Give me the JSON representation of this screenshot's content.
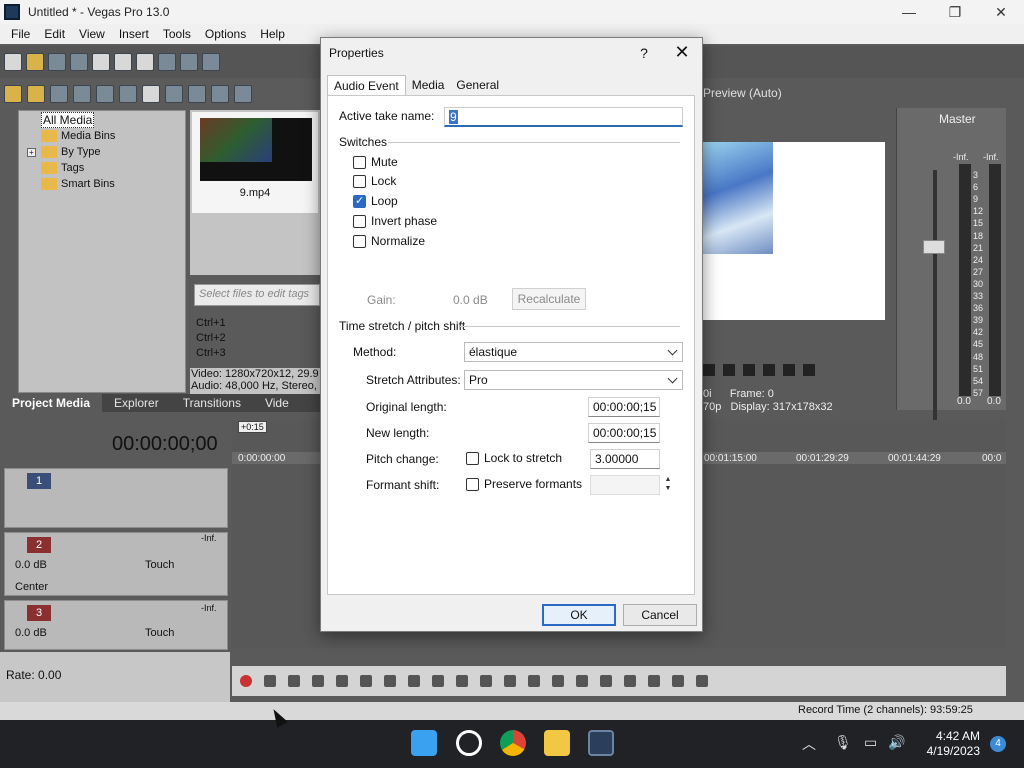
{
  "window": {
    "title": "Untitled * - Vegas Pro 13.0",
    "minimize": "—",
    "maximize": "❐",
    "close": "✕"
  },
  "menu": [
    "File",
    "Edit",
    "View",
    "Insert",
    "Tools",
    "Options",
    "Help"
  ],
  "project_media": {
    "tree": [
      "All Media",
      "Media Bins",
      "By Type",
      "Tags",
      "Smart Bins"
    ],
    "tree_expander": "+",
    "thumbnail_label": "9.mp4",
    "tags_placeholder": "Select files to edit tags",
    "shortcuts": [
      "Ctrl+1",
      "Ctrl+2",
      "Ctrl+3"
    ],
    "info_line1": "Video: 1280x720x12, 29.9",
    "info_line2": "Audio: 48,000 Hz, Stereo,",
    "tabs": [
      "Project Media",
      "Explorer",
      "Transitions",
      "Vide"
    ]
  },
  "preview": {
    "label": "Preview (Auto)",
    "frame_line": "Frame:  0",
    "display_line": "Display:  317x178x32",
    "left_line1": "0i",
    "left_line2": "70p"
  },
  "master": {
    "label": "Master",
    "inf_left": "-Inf.",
    "inf_right": "-Inf.",
    "scale": [
      "3",
      "6",
      "9",
      "12",
      "15",
      "18",
      "21",
      "24",
      "27",
      "30",
      "33",
      "36",
      "39",
      "42",
      "45",
      "48",
      "51",
      "54",
      "57"
    ],
    "val_left": "0.0",
    "val_right": "0.0"
  },
  "timeline": {
    "counter": "00:00:00;00",
    "cursor_tag": "+0:15",
    "ruler": [
      "0:00:00:00",
      "00:01:15:00",
      "00:01:29:29",
      "00:01:44:29",
      "00:0"
    ],
    "track1_num": "1",
    "track2_num": "2",
    "track2_vol": "0.0 dB",
    "track2_pan": "Center",
    "track2_mode": "Touch",
    "track3_num": "3",
    "track3_vol": "0.0 dB",
    "track3_mode": "Touch",
    "inf": "-Inf.",
    "rate": "Rate: 0.00",
    "record_time": "Record Time (2 channels): 93:59:25"
  },
  "taskbar": {
    "time": "4:42 AM",
    "date": "4/19/2023",
    "badge": "4",
    "tray_chevron": "︿"
  },
  "dialog": {
    "title": "Properties",
    "help": "?",
    "close": "✕",
    "tabs": [
      "Audio Event",
      "Media",
      "General"
    ],
    "active_take_label": "Active take name:",
    "active_take_value": "9",
    "switches_header": "Switches",
    "switches": [
      {
        "label": "Mute",
        "checked": false
      },
      {
        "label": "Lock",
        "checked": false
      },
      {
        "label": "Loop",
        "checked": true
      },
      {
        "label": "Invert phase",
        "checked": false
      },
      {
        "label": "Normalize",
        "checked": false
      }
    ],
    "gain_label": "Gain:",
    "gain_value": "0.0 dB",
    "recalculate": "Recalculate",
    "stretch_header": "Time stretch / pitch shift",
    "method_label": "Method:",
    "method_value": "élastique",
    "attributes_label": "Stretch Attributes:",
    "attributes_value": "Pro",
    "original_length_label": "Original length:",
    "original_length_value": "00:00:00;15",
    "new_length_label": "New length:",
    "new_length_value": "00:00:00;15",
    "pitch_label": "Pitch change:",
    "lock_to_stretch": "Lock to stretch",
    "pitch_value": "3.00000",
    "formant_label": "Formant shift:",
    "preserve_formants": "Preserve formants",
    "formant_value": "",
    "ok": "OK",
    "cancel": "Cancel"
  }
}
